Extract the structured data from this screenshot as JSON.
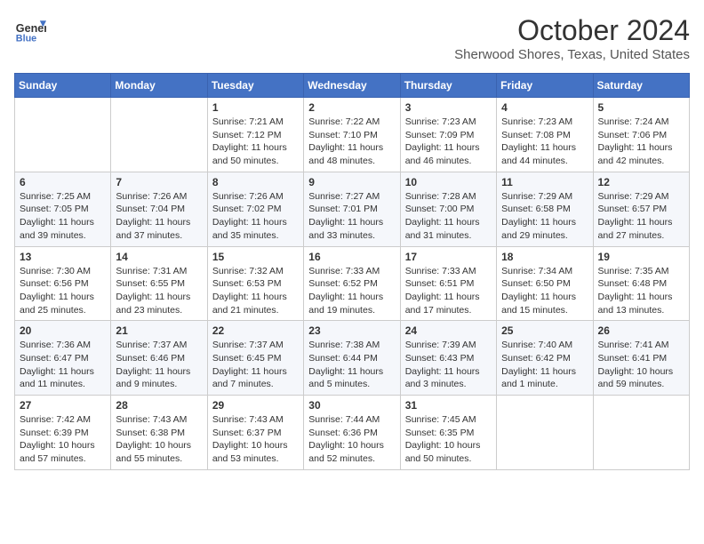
{
  "header": {
    "logo_line1": "General",
    "logo_line2": "Blue",
    "month": "October 2024",
    "location": "Sherwood Shores, Texas, United States"
  },
  "weekdays": [
    "Sunday",
    "Monday",
    "Tuesday",
    "Wednesday",
    "Thursday",
    "Friday",
    "Saturday"
  ],
  "weeks": [
    [
      null,
      null,
      {
        "day": 1,
        "sunrise": "7:21 AM",
        "sunset": "7:12 PM",
        "daylight": "11 hours and 50 minutes."
      },
      {
        "day": 2,
        "sunrise": "7:22 AM",
        "sunset": "7:10 PM",
        "daylight": "11 hours and 48 minutes."
      },
      {
        "day": 3,
        "sunrise": "7:23 AM",
        "sunset": "7:09 PM",
        "daylight": "11 hours and 46 minutes."
      },
      {
        "day": 4,
        "sunrise": "7:23 AM",
        "sunset": "7:08 PM",
        "daylight": "11 hours and 44 minutes."
      },
      {
        "day": 5,
        "sunrise": "7:24 AM",
        "sunset": "7:06 PM",
        "daylight": "11 hours and 42 minutes."
      }
    ],
    [
      {
        "day": 6,
        "sunrise": "7:25 AM",
        "sunset": "7:05 PM",
        "daylight": "11 hours and 39 minutes."
      },
      {
        "day": 7,
        "sunrise": "7:26 AM",
        "sunset": "7:04 PM",
        "daylight": "11 hours and 37 minutes."
      },
      {
        "day": 8,
        "sunrise": "7:26 AM",
        "sunset": "7:02 PM",
        "daylight": "11 hours and 35 minutes."
      },
      {
        "day": 9,
        "sunrise": "7:27 AM",
        "sunset": "7:01 PM",
        "daylight": "11 hours and 33 minutes."
      },
      {
        "day": 10,
        "sunrise": "7:28 AM",
        "sunset": "7:00 PM",
        "daylight": "11 hours and 31 minutes."
      },
      {
        "day": 11,
        "sunrise": "7:29 AM",
        "sunset": "6:58 PM",
        "daylight": "11 hours and 29 minutes."
      },
      {
        "day": 12,
        "sunrise": "7:29 AM",
        "sunset": "6:57 PM",
        "daylight": "11 hours and 27 minutes."
      }
    ],
    [
      {
        "day": 13,
        "sunrise": "7:30 AM",
        "sunset": "6:56 PM",
        "daylight": "11 hours and 25 minutes."
      },
      {
        "day": 14,
        "sunrise": "7:31 AM",
        "sunset": "6:55 PM",
        "daylight": "11 hours and 23 minutes."
      },
      {
        "day": 15,
        "sunrise": "7:32 AM",
        "sunset": "6:53 PM",
        "daylight": "11 hours and 21 minutes."
      },
      {
        "day": 16,
        "sunrise": "7:33 AM",
        "sunset": "6:52 PM",
        "daylight": "11 hours and 19 minutes."
      },
      {
        "day": 17,
        "sunrise": "7:33 AM",
        "sunset": "6:51 PM",
        "daylight": "11 hours and 17 minutes."
      },
      {
        "day": 18,
        "sunrise": "7:34 AM",
        "sunset": "6:50 PM",
        "daylight": "11 hours and 15 minutes."
      },
      {
        "day": 19,
        "sunrise": "7:35 AM",
        "sunset": "6:48 PM",
        "daylight": "11 hours and 13 minutes."
      }
    ],
    [
      {
        "day": 20,
        "sunrise": "7:36 AM",
        "sunset": "6:47 PM",
        "daylight": "11 hours and 11 minutes."
      },
      {
        "day": 21,
        "sunrise": "7:37 AM",
        "sunset": "6:46 PM",
        "daylight": "11 hours and 9 minutes."
      },
      {
        "day": 22,
        "sunrise": "7:37 AM",
        "sunset": "6:45 PM",
        "daylight": "11 hours and 7 minutes."
      },
      {
        "day": 23,
        "sunrise": "7:38 AM",
        "sunset": "6:44 PM",
        "daylight": "11 hours and 5 minutes."
      },
      {
        "day": 24,
        "sunrise": "7:39 AM",
        "sunset": "6:43 PM",
        "daylight": "11 hours and 3 minutes."
      },
      {
        "day": 25,
        "sunrise": "7:40 AM",
        "sunset": "6:42 PM",
        "daylight": "11 hours and 1 minute."
      },
      {
        "day": 26,
        "sunrise": "7:41 AM",
        "sunset": "6:41 PM",
        "daylight": "10 hours and 59 minutes."
      }
    ],
    [
      {
        "day": 27,
        "sunrise": "7:42 AM",
        "sunset": "6:39 PM",
        "daylight": "10 hours and 57 minutes."
      },
      {
        "day": 28,
        "sunrise": "7:43 AM",
        "sunset": "6:38 PM",
        "daylight": "10 hours and 55 minutes."
      },
      {
        "day": 29,
        "sunrise": "7:43 AM",
        "sunset": "6:37 PM",
        "daylight": "10 hours and 53 minutes."
      },
      {
        "day": 30,
        "sunrise": "7:44 AM",
        "sunset": "6:36 PM",
        "daylight": "10 hours and 52 minutes."
      },
      {
        "day": 31,
        "sunrise": "7:45 AM",
        "sunset": "6:35 PM",
        "daylight": "10 hours and 50 minutes."
      },
      null,
      null
    ]
  ]
}
